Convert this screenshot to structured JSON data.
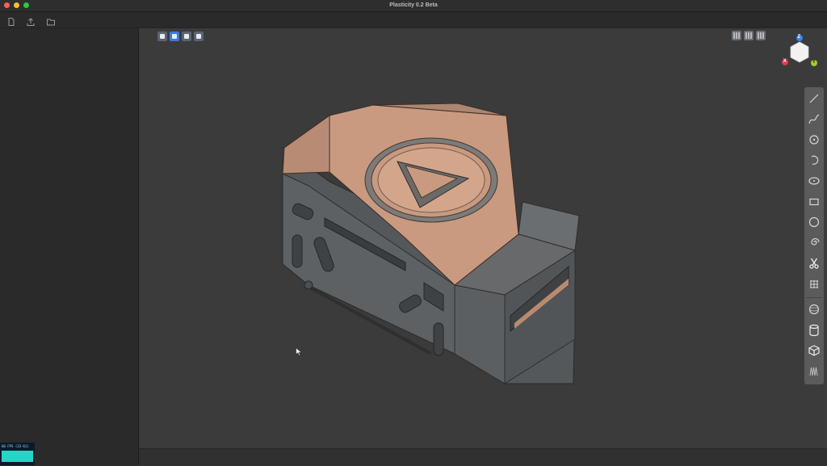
{
  "window": {
    "title": "Plasticity 0.2 Beta"
  },
  "toolbar": {
    "items": [
      {
        "icon": "new-file-icon"
      },
      {
        "icon": "export-icon"
      },
      {
        "icon": "open-folder-icon"
      }
    ]
  },
  "viewport": {
    "view_modes": [
      {
        "icon": "wireframe-view-icon",
        "active": false
      },
      {
        "icon": "shaded-view-icon",
        "active": true
      },
      {
        "icon": "shaded-edges-view-icon",
        "active": false
      },
      {
        "icon": "xray-view-icon",
        "active": false
      }
    ],
    "layout_buttons": [
      {
        "icon": "single-layout-icon"
      },
      {
        "icon": "split-layout-icon"
      },
      {
        "icon": "quad-layout-icon"
      }
    ],
    "gizmo": {
      "z_label": "Z",
      "x_label": "X",
      "y_label": "Y"
    }
  },
  "right_tools": {
    "items": [
      {
        "icon": "line-icon"
      },
      {
        "icon": "curve-icon"
      },
      {
        "icon": "point-icon"
      },
      {
        "icon": "arc-icon"
      },
      {
        "icon": "ellipse-icon"
      },
      {
        "icon": "rectangle-icon"
      },
      {
        "icon": "circle-icon"
      },
      {
        "icon": "spiral-icon"
      },
      {
        "icon": "scissors-icon"
      },
      {
        "icon": "grid-pattern-icon"
      },
      {
        "icon": "sphere-icon"
      },
      {
        "icon": "cylinder-icon"
      },
      {
        "icon": "box-icon"
      },
      {
        "icon": "spring-icon"
      }
    ]
  },
  "stats": {
    "fps_label": "60 FPS (33-61)"
  },
  "colors": {
    "accent": "#3b7dd8",
    "model_top": "#c99a80",
    "model_body": "#5d6062",
    "axis_x": "#e03a4b",
    "axis_y": "#9ccf2d",
    "axis_z": "#2f86f0",
    "fps_graph": "#23d6c7"
  }
}
